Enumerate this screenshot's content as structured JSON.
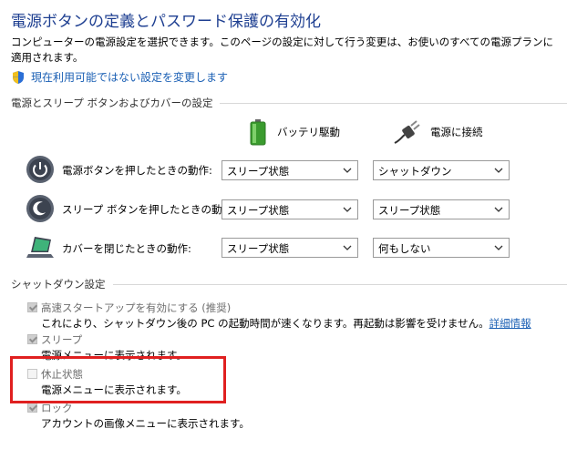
{
  "header": {
    "title": "電源ボタンの定義とパスワード保護の有効化",
    "description": "コンピューターの電源設定を選択できます。このページの設定に対して行う変更は、お使いのすべての電源プランに適用されます。",
    "change_link": "現在利用可能ではない設定を変更します",
    "change_link_icon": "uac-shield-icon"
  },
  "power_section": {
    "heading": "電源とスリープ ボタンおよびカバーの設定",
    "columns": [
      {
        "label": "バッテリ駆動",
        "icon": "battery-icon"
      },
      {
        "label": "電源に接続",
        "icon": "plug-icon"
      }
    ],
    "rows": [
      {
        "label": "電源ボタンを押したときの動作:",
        "icon": "power-button-icon",
        "battery": "スリープ状態",
        "plugged": "シャットダウン"
      },
      {
        "label": "スリープ ボタンを押したときの動作:",
        "icon": "sleep-button-icon",
        "battery": "スリープ状態",
        "plugged": "スリープ状態"
      },
      {
        "label": "カバーを閉じたときの動作:",
        "icon": "laptop-lid-icon",
        "battery": "スリープ状態",
        "plugged": "何もしない"
      }
    ]
  },
  "shutdown_section": {
    "heading": "シャットダウン設定",
    "options": [
      {
        "label": "高速スタートアップを有効にする (推奨)",
        "checked": true,
        "desc": "これにより、シャットダウン後の PC の起動時間が速くなります。再起動は影響を受けません。",
        "desc_link": "詳細情報"
      },
      {
        "label": "スリープ",
        "checked": true,
        "desc": "電源メニューに表示されます。"
      },
      {
        "label": "休止状態",
        "checked": false,
        "desc": "電源メニューに表示されます。"
      },
      {
        "label": "ロック",
        "checked": true,
        "desc": "アカウントの画像メニューに表示されます。"
      }
    ]
  },
  "colors": {
    "highlight": "#e02020",
    "title": "#1e3f91",
    "link": "#1a5fb4"
  }
}
